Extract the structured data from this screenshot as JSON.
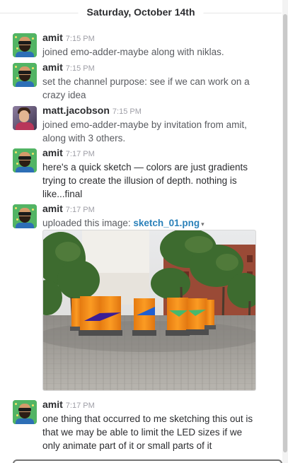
{
  "day_divider": {
    "label": "Saturday, October 14th"
  },
  "messages": [
    {
      "user": "amit",
      "time": "7:15 PM",
      "lines": [
        "joined emo-adder-maybe along with niklas."
      ]
    },
    {
      "user": "amit",
      "time": "7:15 PM",
      "lines": [
        "set the channel purpose: see if we can work on a",
        "crazy idea"
      ]
    },
    {
      "user": "matt.jacobson",
      "time": "7:15 PM",
      "lines": [
        "joined emo-adder-maybe by invitation from amit,",
        "along with 3 others."
      ]
    },
    {
      "user": "amit",
      "time": "7:17 PM",
      "lines": [
        "here's a quick sketch — colors are just gradients",
        "trying to create the illusion of depth. nothing is",
        "like...final"
      ]
    },
    {
      "user": "amit",
      "time": "7:17 PM",
      "upload_prefix": "uploaded this image: ",
      "file_name": "sketch_01.png",
      "file_caret": "▾"
    },
    {
      "user": "amit",
      "time": "7:17 PM",
      "lines": [
        "one thing that occurred to me sketching this out is",
        "that we may be able to limit the LED sizes if we",
        "only animate part of it or small parts of it"
      ]
    }
  ],
  "colors": {
    "link": "#2a80b9",
    "timestamp": "#9e9ea6",
    "body_text": "#595b60",
    "pillar_orange": "#f7931e",
    "shape_purple": "#3b1e96",
    "shape_blue": "#1e5fd1",
    "shape_green": "#47b86d"
  }
}
